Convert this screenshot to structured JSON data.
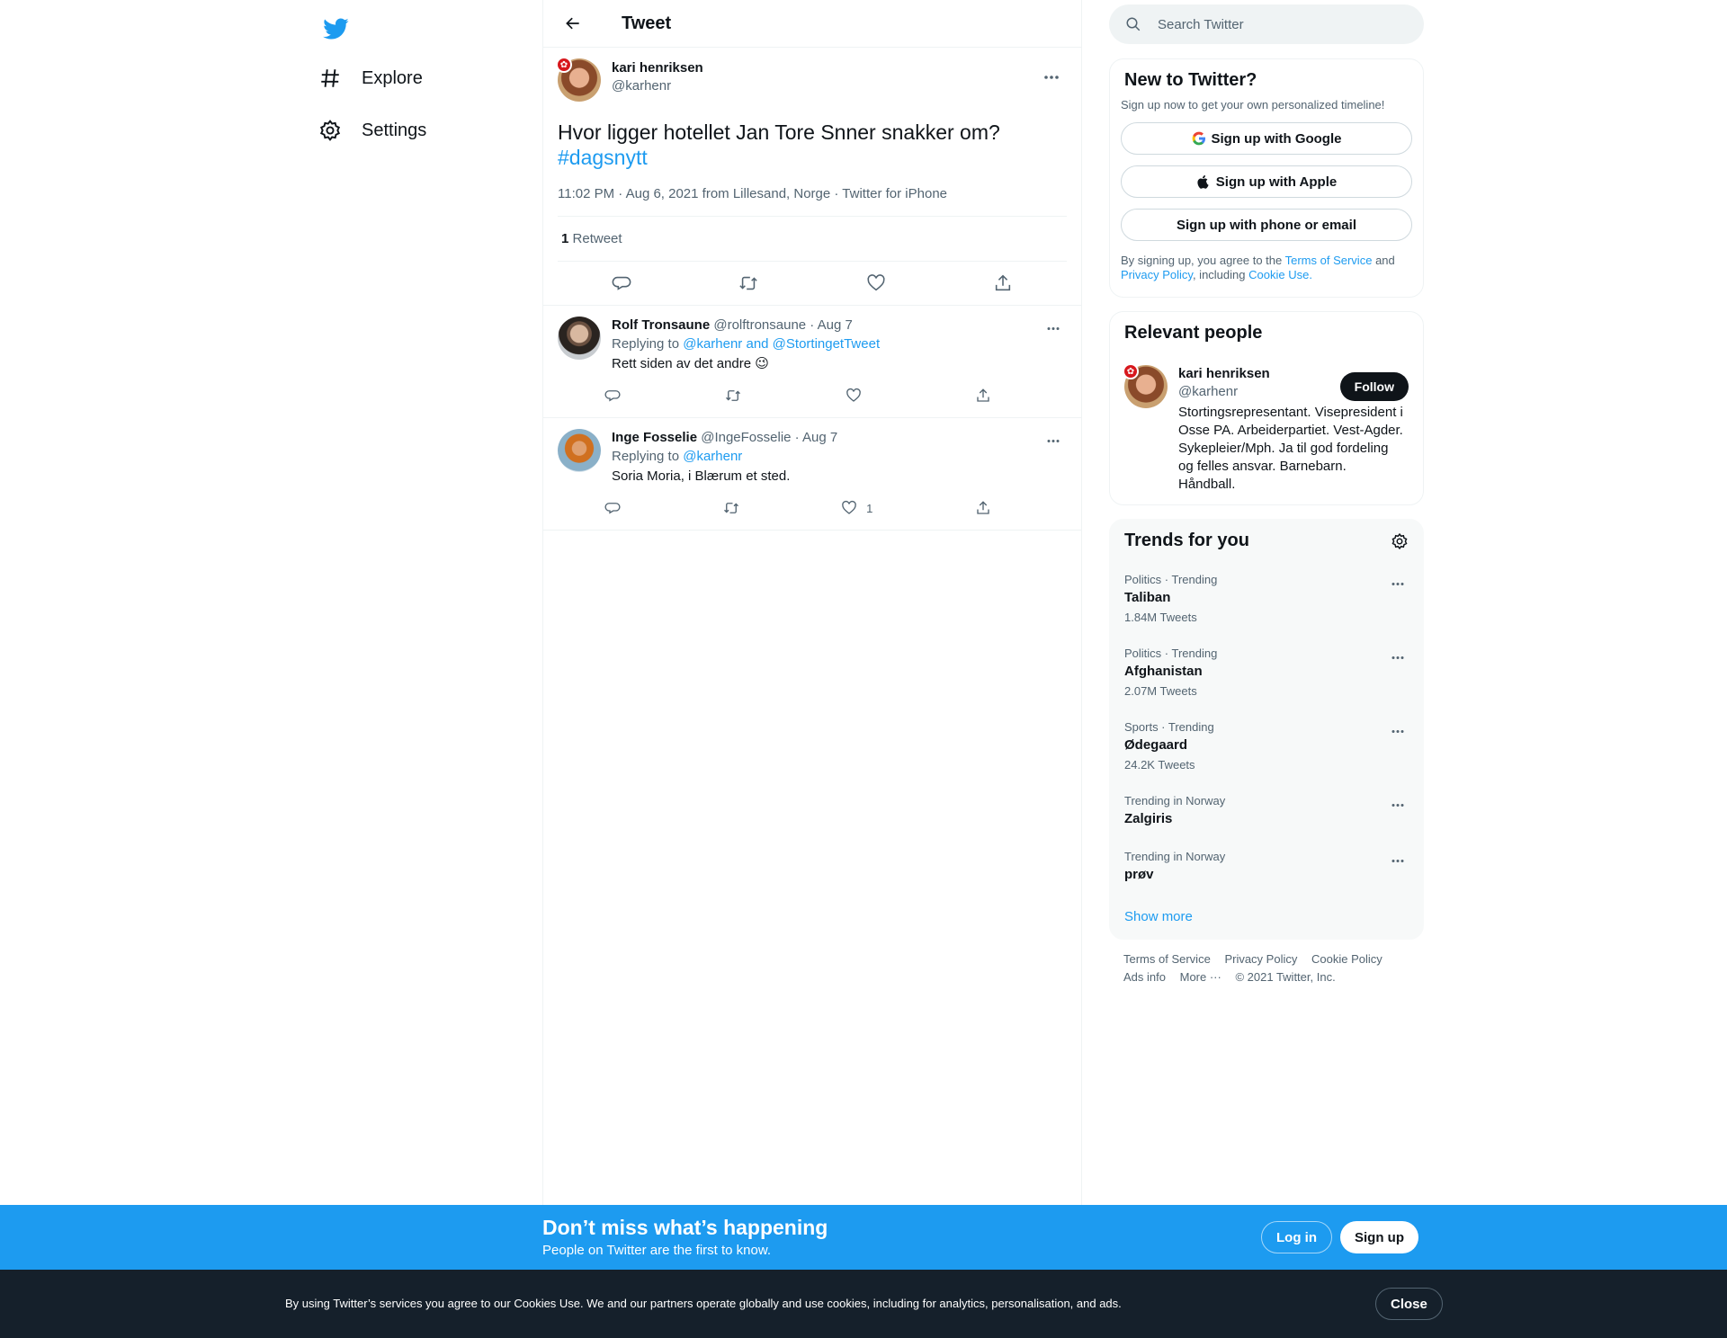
{
  "nav": {
    "items": [
      {
        "label": "Explore"
      },
      {
        "label": "Settings"
      }
    ]
  },
  "header": {
    "title": "Tweet"
  },
  "tweet": {
    "author_name": "kari henriksen",
    "author_handle": "@karhenr",
    "text": "Hvor ligger hotellet Jan Tore Snner snakker om?",
    "hashtag": "#dagsnytt",
    "meta": "11:02 PM · Aug 6, 2021 from Lillesand, Norge · Twitter for iPhone",
    "retweet_count": "1",
    "retweet_label": "Retweet"
  },
  "replies": [
    {
      "name": "Rolf Tronsaune",
      "handle": "@rolftronsaune · Aug 7",
      "replying_prefix": "Replying to",
      "replying_to": "@karhenr and @StortingetTweet",
      "text": "Rett siden av det andre 😉",
      "like_count": ""
    },
    {
      "name": "Inge Fosselie",
      "handle": "@IngeFosselie · Aug 7",
      "replying_prefix": "Replying to",
      "replying_to": "@karhenr",
      "text": "Soria Moria, i Blærum et sted.",
      "like_count": "1"
    }
  ],
  "search": {
    "placeholder": "Search Twitter"
  },
  "signup": {
    "title": "New to Twitter?",
    "subtitle": "Sign up now to get your own personalized timeline!",
    "google": "Sign up with Google",
    "apple": "Sign up with Apple",
    "phone": "Sign up with phone or email",
    "legal_prefix": "By signing up, you agree to the",
    "terms": "Terms of Service",
    "and": "and",
    "privacy": "Privacy Policy",
    "including": ", including",
    "cookie": "Cookie Use."
  },
  "relevant": {
    "title": "Relevant people",
    "name": "kari henriksen",
    "handle": "@karhenr",
    "follow": "Follow",
    "bio": "Stortingsrepresentant. Visepresident i Osse PA. Arbeiderpartiet. Vest-Agder. Sykepleier/Mph. Ja til god fordeling og felles ansvar. Barnebarn. Håndball."
  },
  "trends": {
    "title": "Trends for you",
    "items": [
      {
        "context": "Politics · Trending",
        "name": "Taliban",
        "count": "1.84M Tweets"
      },
      {
        "context": "Politics · Trending",
        "name": "Afghanistan",
        "count": "2.07M Tweets"
      },
      {
        "context": "Sports · Trending",
        "name": "Ødegaard",
        "count": "24.2K Tweets"
      },
      {
        "context": "Trending in Norway",
        "name": "Zalgiris",
        "count": ""
      },
      {
        "context": "Trending in Norway",
        "name": "prøv",
        "count": ""
      }
    ],
    "show_more": "Show more"
  },
  "footer": {
    "terms": "Terms of Service",
    "privacy": "Privacy Policy",
    "cookie": "Cookie Policy",
    "ads": "Ads info",
    "more": "More ···",
    "copyright": "© 2021 Twitter, Inc."
  },
  "banner": {
    "title": "Don’t miss what’s happening",
    "subtitle": "People on Twitter are the first to know.",
    "login": "Log in",
    "signup": "Sign up"
  },
  "cookie_bar": {
    "text": "By using Twitter’s services you agree to our Cookies Use. We and our partners operate globally and use cookies, including for analytics, personalisation, and ads.",
    "close": "Close"
  },
  "colors": {
    "accent": "#1d9bf0",
    "text": "#0f1419",
    "secondary": "#536471",
    "dark": "#15202b"
  }
}
